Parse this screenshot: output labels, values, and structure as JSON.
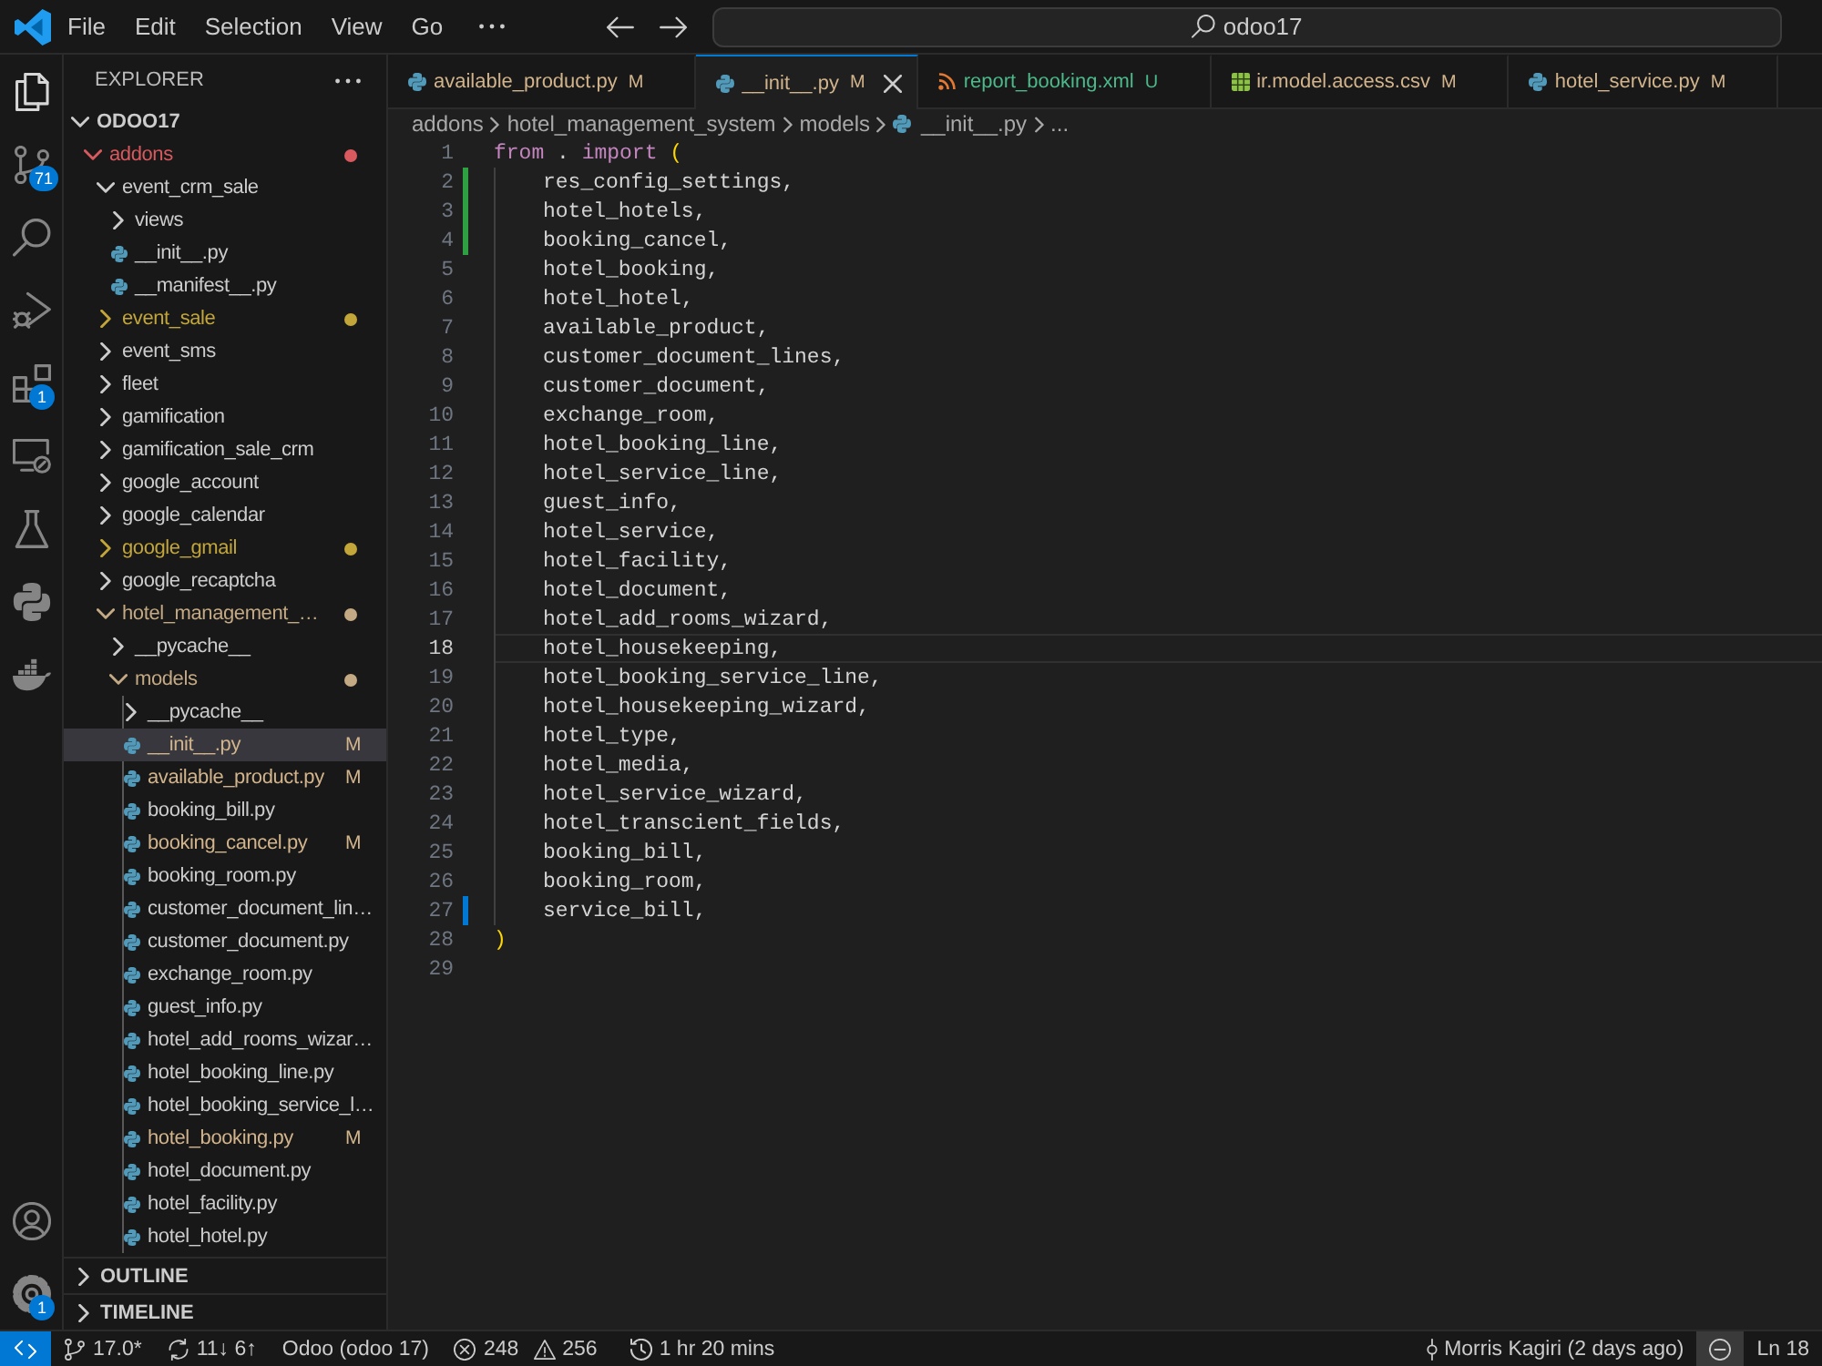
{
  "title_bar": {
    "menu": [
      "File",
      "Edit",
      "Selection",
      "View",
      "Go"
    ],
    "command_center": "odoo17"
  },
  "activity_bar": {
    "top": [
      {
        "kind": "explorer",
        "selected": true
      },
      {
        "kind": "source_control",
        "selected": false,
        "badge": "71"
      },
      {
        "kind": "search",
        "selected": false
      },
      {
        "kind": "run_debug",
        "selected": false
      },
      {
        "kind": "extensions",
        "selected": false,
        "badge": "1"
      },
      {
        "kind": "remote_explorer",
        "selected": false
      },
      {
        "kind": "testing",
        "selected": false
      },
      {
        "kind": "python",
        "selected": false
      },
      {
        "kind": "docker",
        "selected": false
      }
    ],
    "bottom": [
      {
        "kind": "accounts"
      },
      {
        "kind": "manage",
        "badge": "1"
      }
    ]
  },
  "explorer": {
    "title": "EXPLORER",
    "root": {
      "label": "ODOO17",
      "expanded": true,
      "children": [
        {
          "label": "addons",
          "kind": "folder",
          "expanded": true,
          "selected": false,
          "color": "#d95a5e",
          "children": [
            {
              "label": "event_crm_sale",
              "kind": "folder",
              "expanded": true,
              "selected": false,
              "children": [
                {
                  "label": "views",
                  "kind": "folder",
                  "expanded": false,
                  "selected": false
                },
                {
                  "label": "__init__.py",
                  "kind": "python",
                  "selected": false
                },
                {
                  "label": "__manifest__.py",
                  "kind": "python",
                  "selected": false
                }
              ]
            },
            {
              "label": "event_sale",
              "kind": "folder",
              "expanded": false,
              "selected": false,
              "color": "#c2a63a"
            },
            {
              "label": "event_sms",
              "kind": "folder",
              "expanded": false,
              "selected": false
            },
            {
              "label": "fleet",
              "kind": "folder",
              "expanded": false,
              "selected": false
            },
            {
              "label": "gamification",
              "kind": "folder",
              "expanded": false,
              "selected": false
            },
            {
              "label": "gamification_sale_crm",
              "kind": "folder",
              "expanded": false,
              "selected": false
            },
            {
              "label": "google_account",
              "kind": "folder",
              "expanded": false,
              "selected": false
            },
            {
              "label": "google_calendar",
              "kind": "folder",
              "expanded": false,
              "selected": false
            },
            {
              "label": "google_gmail",
              "kind": "folder",
              "expanded": false,
              "selected": false,
              "color": "#c2a63a"
            },
            {
              "label": "google_recaptcha",
              "kind": "folder",
              "expanded": false,
              "selected": false
            },
            {
              "label": "hotel_management_…",
              "kind": "folder",
              "expanded": true,
              "selected": false,
              "color": "#c4aa84",
              "children": [
                {
                  "label": "__pycache__",
                  "kind": "folder",
                  "expanded": false,
                  "selected": false
                },
                {
                  "label": "models",
                  "kind": "folder",
                  "expanded": true,
                  "selected": false,
                  "color": "#c4aa84",
                  "children": [
                    {
                      "label": "__pycache__",
                      "kind": "folder",
                      "expanded": false,
                      "selected": false
                    },
                    {
                      "label": "__init__.py",
                      "kind": "python",
                      "selected": true,
                      "color": "#d2b48c",
                      "badge": "M"
                    },
                    {
                      "label": "available_product.py",
                      "kind": "python",
                      "selected": false,
                      "color": "#d2b48c",
                      "badge": "M"
                    },
                    {
                      "label": "booking_bill.py",
                      "kind": "python",
                      "selected": false
                    },
                    {
                      "label": "booking_cancel.py",
                      "kind": "python",
                      "selected": false,
                      "color": "#d2b48c",
                      "badge": "M"
                    },
                    {
                      "label": "booking_room.py",
                      "kind": "python",
                      "selected": false
                    },
                    {
                      "label": "customer_document_lin…",
                      "kind": "python",
                      "selected": false
                    },
                    {
                      "label": "customer_document.py",
                      "kind": "python",
                      "selected": false
                    },
                    {
                      "label": "exchange_room.py",
                      "kind": "python",
                      "selected": false
                    },
                    {
                      "label": "guest_info.py",
                      "kind": "python",
                      "selected": false
                    },
                    {
                      "label": "hotel_add_rooms_wizar…",
                      "kind": "python",
                      "selected": false
                    },
                    {
                      "label": "hotel_booking_line.py",
                      "kind": "python",
                      "selected": false
                    },
                    {
                      "label": "hotel_booking_service_l…",
                      "kind": "python",
                      "selected": false
                    },
                    {
                      "label": "hotel_booking.py",
                      "kind": "python",
                      "selected": false,
                      "color": "#d2b48c",
                      "badge": "M"
                    },
                    {
                      "label": "hotel_document.py",
                      "kind": "python",
                      "selected": false
                    },
                    {
                      "label": "hotel_facility.py",
                      "kind": "python",
                      "selected": false
                    },
                    {
                      "label": "hotel_hotel.py",
                      "kind": "python",
                      "selected": false
                    }
                  ]
                }
              ]
            }
          ]
        }
      ]
    },
    "sections": [
      {
        "label": "OUTLINE",
        "expanded": false
      },
      {
        "label": "TIMELINE",
        "expanded": false
      }
    ]
  },
  "tabs": [
    {
      "label": "available_product.py",
      "kind": "python",
      "badge": "M",
      "color": "#d2b48c",
      "selected": false
    },
    {
      "label": "__init__.py",
      "kind": "python",
      "badge": "M",
      "color": "#d2b48c",
      "selected": true
    },
    {
      "label": "report_booking.xml",
      "kind": "xml",
      "badge": "U",
      "color": "#4cb98a",
      "selected": false
    },
    {
      "label": "ir.model.access.csv",
      "kind": "csv",
      "badge": "M",
      "color": "#d2b48c",
      "selected": false
    },
    {
      "label": "hotel_service.py",
      "kind": "python",
      "badge": "M",
      "color": "#d2b48c",
      "selected": false
    }
  ],
  "breadcrumbs": [
    {
      "label": "addons",
      "kind": "folder"
    },
    {
      "label": "hotel_management_system",
      "kind": "folder"
    },
    {
      "label": "models",
      "kind": "folder"
    },
    {
      "label": "__init__.py",
      "kind": "python"
    },
    {
      "label": "...",
      "kind": "symbol"
    }
  ],
  "editor": {
    "lines": [
      {
        "number": "1",
        "kind": "unchanged",
        "indent": false,
        "current": false,
        "tokens": [
          {
            "kind": "keyword",
            "text": "from"
          },
          {
            "kind": "plain",
            "text": " . "
          },
          {
            "kind": "keyword",
            "text": "import"
          },
          {
            "kind": "bracket",
            "text": " ("
          }
        ]
      },
      {
        "number": "2",
        "kind": "added",
        "indent": true,
        "current": false,
        "tokens": [
          {
            "kind": "name",
            "text": "res_config_settings,"
          }
        ]
      },
      {
        "number": "3",
        "kind": "added",
        "indent": true,
        "current": false,
        "tokens": [
          {
            "kind": "name",
            "text": "hotel_hotels,"
          }
        ]
      },
      {
        "number": "4",
        "kind": "added",
        "indent": true,
        "current": false,
        "tokens": [
          {
            "kind": "name",
            "text": "booking_cancel,"
          }
        ]
      },
      {
        "number": "5",
        "kind": "unchanged",
        "indent": true,
        "current": false,
        "tokens": [
          {
            "kind": "name",
            "text": "hotel_booking,"
          }
        ]
      },
      {
        "number": "6",
        "kind": "unchanged",
        "indent": true,
        "current": false,
        "tokens": [
          {
            "kind": "name",
            "text": "hotel_hotel,"
          }
        ]
      },
      {
        "number": "7",
        "kind": "unchanged",
        "indent": true,
        "current": false,
        "tokens": [
          {
            "kind": "name",
            "text": "available_product,"
          }
        ]
      },
      {
        "number": "8",
        "kind": "unchanged",
        "indent": true,
        "current": false,
        "tokens": [
          {
            "kind": "name",
            "text": "customer_document_lines,"
          }
        ]
      },
      {
        "number": "9",
        "kind": "unchanged",
        "indent": true,
        "current": false,
        "tokens": [
          {
            "kind": "name",
            "text": "customer_document,"
          }
        ]
      },
      {
        "number": "10",
        "kind": "unchanged",
        "indent": true,
        "current": false,
        "tokens": [
          {
            "kind": "name",
            "text": "exchange_room,"
          }
        ]
      },
      {
        "number": "11",
        "kind": "unchanged",
        "indent": true,
        "current": false,
        "tokens": [
          {
            "kind": "name",
            "text": "hotel_booking_line,"
          }
        ]
      },
      {
        "number": "12",
        "kind": "unchanged",
        "indent": true,
        "current": false,
        "tokens": [
          {
            "kind": "name",
            "text": "hotel_service_line,"
          }
        ]
      },
      {
        "number": "13",
        "kind": "unchanged",
        "indent": true,
        "current": false,
        "tokens": [
          {
            "kind": "name",
            "text": "guest_info,"
          }
        ]
      },
      {
        "number": "14",
        "kind": "unchanged",
        "indent": true,
        "current": false,
        "tokens": [
          {
            "kind": "name",
            "text": "hotel_service,"
          }
        ]
      },
      {
        "number": "15",
        "kind": "unchanged",
        "indent": true,
        "current": false,
        "tokens": [
          {
            "kind": "name",
            "text": "hotel_facility,"
          }
        ]
      },
      {
        "number": "16",
        "kind": "unchanged",
        "indent": true,
        "current": false,
        "tokens": [
          {
            "kind": "name",
            "text": "hotel_document,"
          }
        ]
      },
      {
        "number": "17",
        "kind": "unchanged",
        "indent": true,
        "current": false,
        "tokens": [
          {
            "kind": "name",
            "text": "hotel_add_rooms_wizard,"
          }
        ]
      },
      {
        "number": "18",
        "kind": "unchanged",
        "indent": true,
        "current": true,
        "tokens": [
          {
            "kind": "name",
            "text": "hotel_housekeeping,"
          }
        ]
      },
      {
        "number": "19",
        "kind": "unchanged",
        "indent": true,
        "current": false,
        "tokens": [
          {
            "kind": "name",
            "text": "hotel_booking_service_line,"
          }
        ]
      },
      {
        "number": "20",
        "kind": "unchanged",
        "indent": true,
        "current": false,
        "tokens": [
          {
            "kind": "name",
            "text": "hotel_housekeeping_wizard,"
          }
        ]
      },
      {
        "number": "21",
        "kind": "unchanged",
        "indent": true,
        "current": false,
        "tokens": [
          {
            "kind": "name",
            "text": "hotel_type,"
          }
        ]
      },
      {
        "number": "22",
        "kind": "unchanged",
        "indent": true,
        "current": false,
        "tokens": [
          {
            "kind": "name",
            "text": "hotel_media,"
          }
        ]
      },
      {
        "number": "23",
        "kind": "unchanged",
        "indent": true,
        "current": false,
        "tokens": [
          {
            "kind": "name",
            "text": "hotel_service_wizard,"
          }
        ]
      },
      {
        "number": "24",
        "kind": "unchanged",
        "indent": true,
        "current": false,
        "tokens": [
          {
            "kind": "name",
            "text": "hotel_transcient_fields,"
          }
        ]
      },
      {
        "number": "25",
        "kind": "unchanged",
        "indent": true,
        "current": false,
        "tokens": [
          {
            "kind": "name",
            "text": "booking_bill,"
          }
        ]
      },
      {
        "number": "26",
        "kind": "unchanged",
        "indent": true,
        "current": false,
        "tokens": [
          {
            "kind": "name",
            "text": "booking_room,"
          }
        ]
      },
      {
        "number": "27",
        "kind": "modified",
        "indent": true,
        "current": false,
        "tokens": [
          {
            "kind": "name",
            "text": "service_bill,"
          }
        ]
      },
      {
        "number": "28",
        "kind": "unchanged",
        "indent": false,
        "current": false,
        "tokens": [
          {
            "kind": "bracket",
            "text": ")"
          }
        ]
      },
      {
        "number": "29",
        "kind": "unchanged",
        "indent": false,
        "current": false
      }
    ]
  },
  "status_bar": {
    "left": [
      {
        "kind": "remote"
      },
      {
        "kind": "branch",
        "text": "17.0*"
      },
      {
        "kind": "sync",
        "text": "11↓ 6↑"
      },
      {
        "kind": "plain",
        "text": "Odoo (odoo 17)"
      },
      {
        "kind": "problems",
        "errors": "248",
        "warnings": "256"
      },
      {
        "kind": "timer",
        "text": "1 hr 20 mins"
      }
    ],
    "right": [
      {
        "kind": "blame",
        "text": "Morris Kagiri (2 days ago)"
      },
      {
        "kind": "indicator"
      },
      {
        "kind": "plain",
        "text": "Ln 18"
      }
    ]
  }
}
